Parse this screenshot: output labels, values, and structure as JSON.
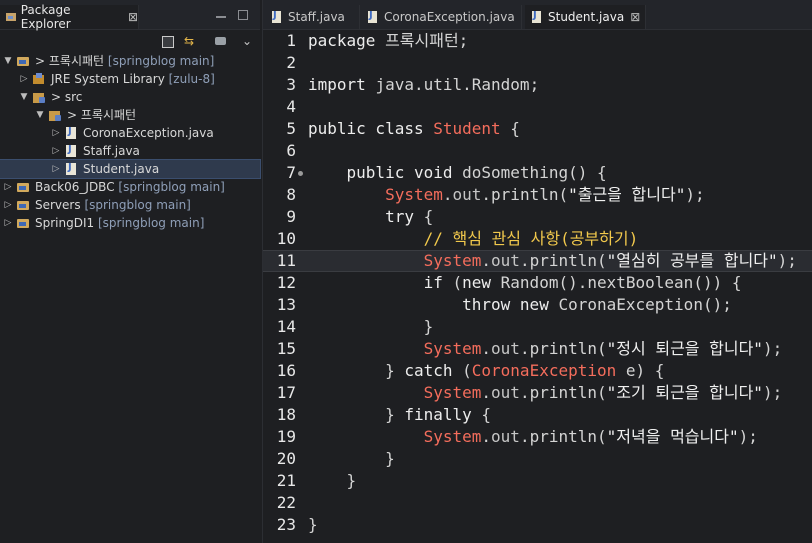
{
  "explorer": {
    "tab_label": "Package Explorer",
    "close_glyph": "⊠",
    "tree": [
      {
        "label": "프록시패턴",
        "suffix": "[springblog main]",
        "prefix": "> ",
        "twist": "▼",
        "icon": "project-icon",
        "indent": 0
      },
      {
        "label": "JRE System Library",
        "suffix": "[zulu-8]",
        "prefix": "",
        "twist": "▷",
        "icon": "library-icon",
        "indent": 1
      },
      {
        "label": "src",
        "suffix": "",
        "prefix": "> ",
        "twist": "▼",
        "icon": "source-folder-icon",
        "indent": 1
      },
      {
        "label": "프록시패턴",
        "suffix": "",
        "prefix": "> ",
        "twist": "▼",
        "icon": "package-icon",
        "indent": 2
      },
      {
        "label": "CoronaException.java",
        "suffix": "",
        "prefix": "",
        "twist": "▷",
        "icon": "java-file-icon",
        "indent": 3
      },
      {
        "label": "Staff.java",
        "suffix": "",
        "prefix": "",
        "twist": "▷",
        "icon": "java-file-icon",
        "indent": 3
      },
      {
        "label": "Student.java",
        "suffix": "",
        "prefix": "",
        "twist": "▷",
        "icon": "java-file-icon",
        "indent": 3,
        "selected": true
      },
      {
        "label": "Back06_JDBC",
        "suffix": "[springblog main]",
        "prefix": "",
        "twist": "▷",
        "icon": "project-icon",
        "indent": 0
      },
      {
        "label": "Servers",
        "suffix": "[springblog main]",
        "prefix": "",
        "twist": "▷",
        "icon": "project-icon",
        "indent": 0
      },
      {
        "label": "SpringDI1",
        "suffix": "[springblog main]",
        "prefix": "",
        "twist": "▷",
        "icon": "project-icon",
        "indent": 0
      }
    ]
  },
  "editor": {
    "tabs": [
      {
        "label": "Staff.java",
        "active": false
      },
      {
        "label": "CoronaException.java",
        "active": false
      },
      {
        "label": "Student.java",
        "active": true
      }
    ],
    "close_glyph": "⊠",
    "current_line": 11,
    "lines": [
      {
        "n": "1",
        "tokens": [
          [
            "kw",
            "package "
          ],
          [
            "",
            "프록시패턴;"
          ]
        ]
      },
      {
        "n": "2",
        "tokens": []
      },
      {
        "n": "3",
        "tokens": [
          [
            "kw",
            "import "
          ],
          [
            "",
            "java.util.Random;"
          ]
        ]
      },
      {
        "n": "4",
        "tokens": []
      },
      {
        "n": "5",
        "tokens": [
          [
            "kw",
            "public class "
          ],
          [
            "cls",
            "Student"
          ],
          [
            "",
            " {"
          ]
        ]
      },
      {
        "n": "6",
        "tokens": []
      },
      {
        "n": "7",
        "marker": true,
        "tokens": [
          [
            "",
            "    "
          ],
          [
            "kw",
            "public void "
          ],
          [
            "",
            "doSomething() {"
          ]
        ]
      },
      {
        "n": "8",
        "tokens": [
          [
            "",
            "        "
          ],
          [
            "cls",
            "System"
          ],
          [
            "",
            "."
          ],
          [
            "fld",
            "out"
          ],
          [
            "",
            ".println("
          ],
          [
            "str",
            "\"출근을 합니다\""
          ],
          [
            "",
            ");"
          ]
        ]
      },
      {
        "n": "9",
        "tokens": [
          [
            "",
            "        "
          ],
          [
            "kw",
            "try"
          ],
          [
            "",
            " {"
          ]
        ]
      },
      {
        "n": "10",
        "tokens": [
          [
            "",
            "            "
          ],
          [
            "cmt",
            "// 핵심 관심 사항(공부하기)"
          ]
        ]
      },
      {
        "n": "11",
        "tokens": [
          [
            "",
            "            "
          ],
          [
            "cls",
            "System"
          ],
          [
            "",
            "."
          ],
          [
            "fld",
            "out"
          ],
          [
            "",
            ".println("
          ],
          [
            "str",
            "\"열심히 공부를 합니다\""
          ],
          [
            "",
            ");"
          ]
        ]
      },
      {
        "n": "12",
        "tokens": [
          [
            "",
            "            "
          ],
          [
            "kw",
            "if"
          ],
          [
            "",
            " ("
          ],
          [
            "kw",
            "new "
          ],
          [
            "",
            "Random().nextBoolean()) {"
          ]
        ]
      },
      {
        "n": "13",
        "tokens": [
          [
            "",
            "                "
          ],
          [
            "kw",
            "throw new "
          ],
          [
            "",
            "CoronaException();"
          ]
        ]
      },
      {
        "n": "14",
        "tokens": [
          [
            "",
            "            }"
          ]
        ]
      },
      {
        "n": "15",
        "tokens": [
          [
            "",
            "            "
          ],
          [
            "cls",
            "System"
          ],
          [
            "",
            "."
          ],
          [
            "fld",
            "out"
          ],
          [
            "",
            ".println("
          ],
          [
            "str",
            "\"정시 퇴근을 합니다\""
          ],
          [
            "",
            ");"
          ]
        ]
      },
      {
        "n": "16",
        "tokens": [
          [
            "",
            "        } "
          ],
          [
            "kw",
            "catch"
          ],
          [
            "",
            " ("
          ],
          [
            "cls",
            "CoronaException"
          ],
          [
            "",
            " e) {"
          ]
        ]
      },
      {
        "n": "17",
        "tokens": [
          [
            "",
            "            "
          ],
          [
            "cls",
            "System"
          ],
          [
            "",
            "."
          ],
          [
            "fld",
            "out"
          ],
          [
            "",
            ".println("
          ],
          [
            "str",
            "\"조기 퇴근을 합니다\""
          ],
          [
            "",
            ");"
          ]
        ]
      },
      {
        "n": "18",
        "tokens": [
          [
            "",
            "        } "
          ],
          [
            "kw",
            "finally"
          ],
          [
            "",
            " {"
          ]
        ]
      },
      {
        "n": "19",
        "tokens": [
          [
            "",
            "            "
          ],
          [
            "cls",
            "System"
          ],
          [
            "",
            "."
          ],
          [
            "fld",
            "out"
          ],
          [
            "",
            ".println("
          ],
          [
            "str",
            "\"저녁을 먹습니다\""
          ],
          [
            "",
            ");"
          ]
        ]
      },
      {
        "n": "20",
        "tokens": [
          [
            "",
            "        }"
          ]
        ]
      },
      {
        "n": "21",
        "tokens": [
          [
            "",
            "    }"
          ]
        ]
      },
      {
        "n": "22",
        "tokens": []
      },
      {
        "n": "23",
        "tokens": [
          [
            "",
            "}"
          ]
        ]
      }
    ]
  }
}
